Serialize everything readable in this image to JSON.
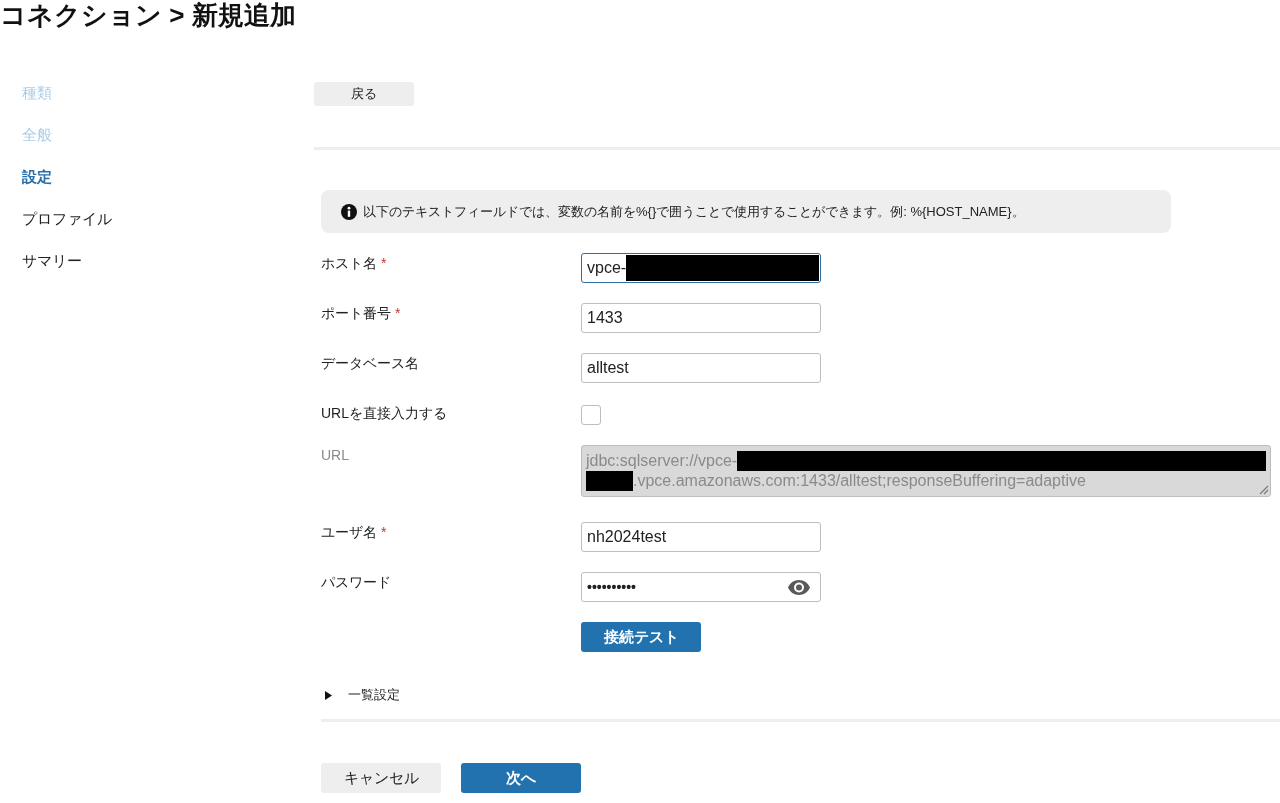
{
  "page": {
    "title": "コネクション > 新規追加"
  },
  "steps": [
    {
      "label": "種類",
      "done": true,
      "selected": false
    },
    {
      "label": "全般",
      "done": true,
      "selected": false
    },
    {
      "label": "設定",
      "done": false,
      "selected": true
    },
    {
      "label": "プロファイル",
      "done": false,
      "selected": false
    },
    {
      "label": "サマリー",
      "done": false,
      "selected": false
    }
  ],
  "back_button": "戻る",
  "info": {
    "text": "以下のテキストフィールドでは、変数の名前を%{}で囲うことで使用することができます。例: %{HOST_NAME}。"
  },
  "fields": [
    {
      "kind": "text",
      "label": "ホスト名",
      "required_mark": "*",
      "focused": true,
      "value_parts": [
        {
          "kind": "text",
          "text": "vpce-"
        },
        {
          "kind": "redacted"
        }
      ]
    },
    {
      "kind": "text",
      "label": "ポート番号",
      "required_mark": "*",
      "focused": false,
      "value_parts": [
        {
          "kind": "text",
          "text": "1433"
        }
      ]
    },
    {
      "kind": "text",
      "label": "データベース名",
      "focused": false,
      "value_parts": [
        {
          "kind": "text",
          "text": "alltest"
        }
      ]
    },
    {
      "kind": "checkbox",
      "label": "URLを直接入力する",
      "checked": false
    },
    {
      "kind": "textarea",
      "label": "URL",
      "disabled": true,
      "lines": [
        [
          {
            "kind": "text",
            "text": "jdbc:sqlserver://vpce-"
          },
          {
            "kind": "redacted"
          }
        ],
        [
          {
            "kind": "redacted"
          },
          {
            "kind": "text",
            "text": ".vpce.amazonaws.com:1433/alltest;responseBuffering=adaptive"
          }
        ]
      ]
    },
    {
      "kind": "text",
      "label": "ユーザ名",
      "required_mark": "*",
      "focused": false,
      "value_parts": [
        {
          "kind": "text",
          "text": "nh2024test"
        }
      ]
    },
    {
      "kind": "password",
      "label": "パスワード",
      "value": "••••••••••"
    }
  ],
  "test_button": "接続テスト",
  "advanced": {
    "label": "一覧設定",
    "expanded": false
  },
  "footer": {
    "cancel": "キャンセル",
    "next": "次へ"
  }
}
